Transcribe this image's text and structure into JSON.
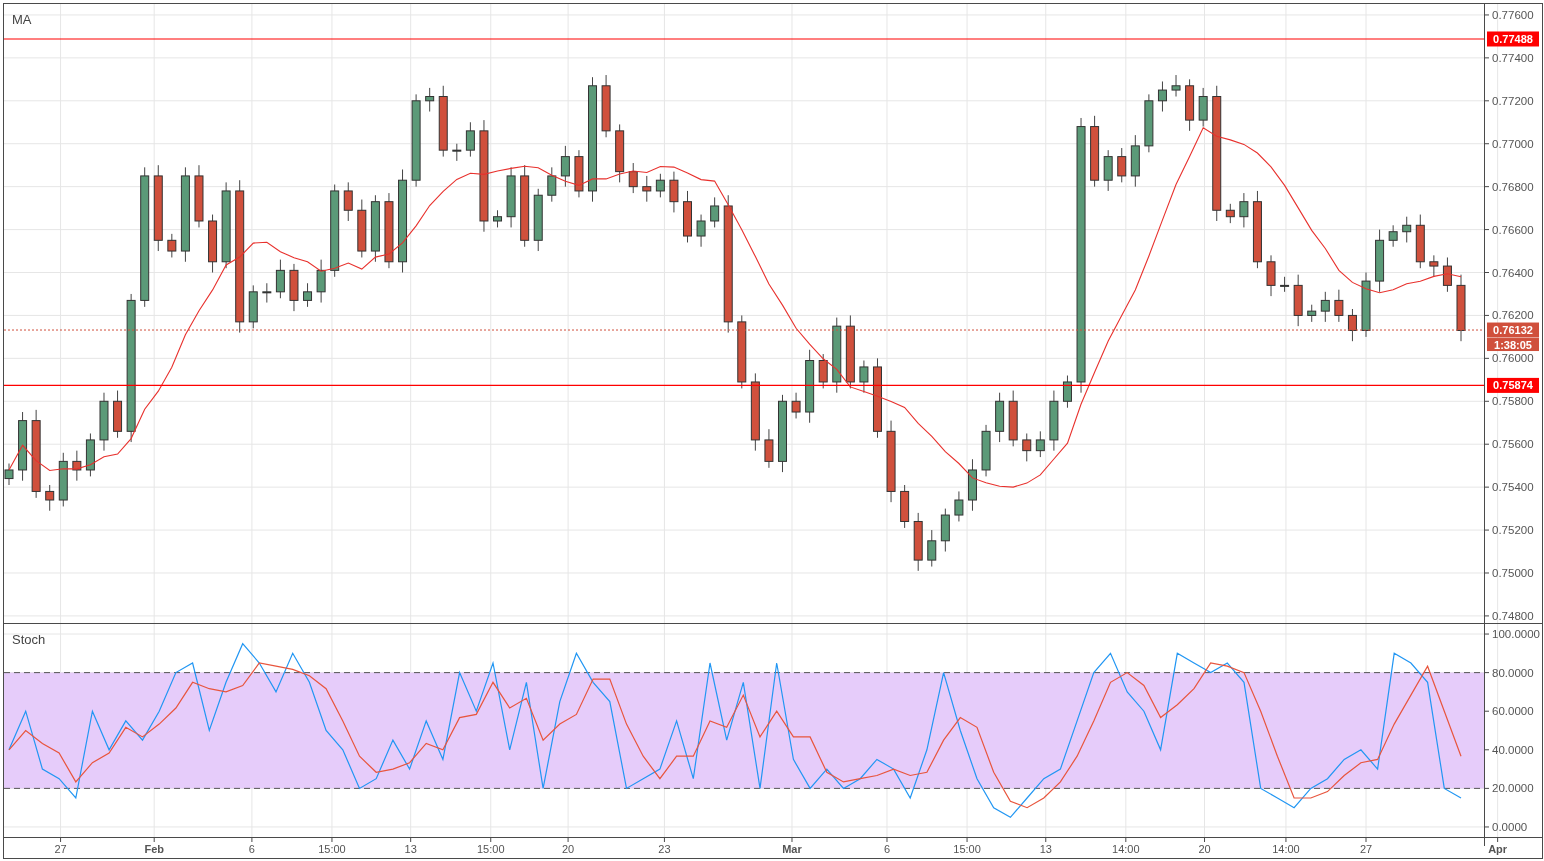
{
  "price_panel": {
    "title": "MA",
    "axis_labels": [
      "0.77600",
      "0.77400",
      "0.77200",
      "0.77000",
      "0.76800",
      "0.76600",
      "0.76400",
      "0.76200",
      "0.76000",
      "0.75800",
      "0.75600",
      "0.75400",
      "0.75200",
      "0.75000",
      "0.74800"
    ],
    "price_tags": [
      {
        "kind": "level",
        "label": "0.77488"
      },
      {
        "kind": "current",
        "label": "0.76132",
        "countdown": "1:38:05"
      },
      {
        "kind": "level",
        "label": "0.75874"
      }
    ]
  },
  "stoch_panel": {
    "title": "Stoch",
    "axis_labels": [
      "100.0000",
      "80.0000",
      "60.0000",
      "40.0000",
      "20.0000",
      "0.0000"
    ]
  },
  "time_axis": [
    {
      "label": "27",
      "major": false
    },
    {
      "label": "Feb",
      "major": true
    },
    {
      "label": "6",
      "major": false
    },
    {
      "label": "15:00",
      "major": false
    },
    {
      "label": "13",
      "major": false
    },
    {
      "label": "15:00",
      "major": false
    },
    {
      "label": "20",
      "major": false
    },
    {
      "label": "23",
      "major": false
    },
    {
      "label": "Mar",
      "major": true
    },
    {
      "label": "6",
      "major": false
    },
    {
      "label": "15:00",
      "major": false
    },
    {
      "label": "13",
      "major": false
    },
    {
      "label": "14:00",
      "major": false
    },
    {
      "label": "20",
      "major": false
    },
    {
      "label": "14:00",
      "major": false
    },
    {
      "label": "27",
      "major": false
    },
    {
      "label": "Apr",
      "major": true
    }
  ]
}
